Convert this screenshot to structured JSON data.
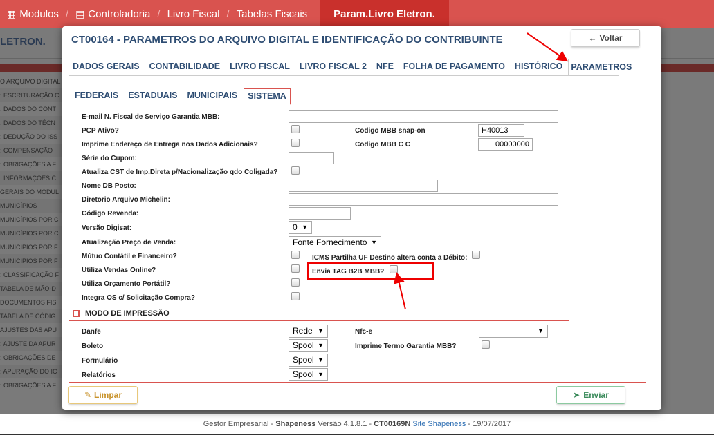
{
  "topnav": {
    "items": [
      {
        "icon": "grid-icon",
        "glyph": "▦",
        "label": "Modulos"
      },
      {
        "icon": "document-icon",
        "glyph": "▤",
        "label": "Controladoria"
      },
      {
        "label": "Livro Fiscal"
      },
      {
        "label": "Tabelas Fiscais"
      }
    ],
    "active": "Param.Livro Eletron."
  },
  "background": {
    "title": "LETRON.",
    "list": [
      "O ARQUIVO DIGITAL",
      ": ESCRITURAÇÃO C",
      ": DADOS DO CONT",
      ": DADOS DO TÉCN",
      ": DEDUÇÃO DO ISS",
      ": COMPENSAÇÃO",
      ": OBRIGAÇÕES A F",
      ": INFORMAÇÕES C",
      "GERAIS DO MODUL",
      "MUNICÍPIOS",
      "MUNICÍPIOS POR C",
      "MUNICÍPIOS POR C",
      "MUNICÍPIOS POR F",
      "MUNICÍPIOS POR F",
      ": CLASSIFICAÇÃO F",
      "TABELA DE MÃO-D",
      "DOCUMENTOS FIS",
      "TABELA DE CÓDIG",
      "AJUSTES DAS APU",
      ": AJUSTE DA APUR",
      ": OBRIGAÇÕES DE",
      ": APURAÇÃO DO IC",
      ": OBRIGAÇÕES A F"
    ]
  },
  "modal": {
    "title": "CT00164 - PARAMETROS DO ARQUIVO DIGITAL E IDENTIFICAÇÃO DO CONTRIBUINTE",
    "voltar": "Voltar",
    "limpar": "Limpar",
    "enviar": "Enviar",
    "tabs": [
      "DADOS GERAIS",
      "CONTABILIDADE",
      "LIVRO FISCAL",
      "LIVRO FISCAL 2",
      "NFE",
      "FOLHA DE PAGAMENTO",
      "HISTÓRICO",
      "PARAMETROS"
    ],
    "subtabs": [
      "FEDERAIS",
      "ESTADUAIS",
      "MUNICIPAIS",
      "SISTEMA"
    ],
    "fields": {
      "email_nf": "E-mail N. Fiscal de Serviço Garantia MBB:",
      "pcp_ativo": "PCP Ativo?",
      "codigo_snapon": "Codigo MBB snap-on",
      "codigo_snapon_value": "H40013",
      "imprime_endereco": "Imprime Endereço de Entrega nos Dados Adicionais?",
      "codigo_mbb_cc": "Codigo MBB C C",
      "codigo_mbb_cc_value": "00000000",
      "serie_cupom": "Série do Cupom:",
      "atualiza_cst": "Atualiza CST de Imp.Direta p/Nacionalização qdo Coligada?",
      "nome_db_posto": "Nome DB Posto:",
      "diretorio_michelin": "Diretorio Arquivo Michelin:",
      "codigo_revenda": "Código Revenda:",
      "versao_digisat": "Versão Digisat:",
      "versao_digisat_value": "0",
      "atualizacao_preco": "Atualização Preço de Venda:",
      "atualizacao_preco_value": "Fonte Fornecimento",
      "mutuo_contabil": "Mútuo Contátil e Financeiro?",
      "icms_partilha": "ICMS Partilha UF Destino altera conta a Débito:",
      "utiliza_vendas": "Utiliza Vendas Online?",
      "envia_tag": "Envia TAG B2B MBB?",
      "utiliza_orcamento": "Utiliza Orçamento Portátil?",
      "integra_os": "Integra OS c/ Solicitação Compra?"
    },
    "print_section": {
      "title": "MODO DE IMPRESSÃO",
      "danfe": "Danfe",
      "danfe_value": "Rede",
      "nfce": "Nfc-e",
      "nfce_value": "",
      "boleto": "Boleto",
      "boleto_value": "Spool",
      "imprime_termo": "Imprime Termo Garantia MBB?",
      "formulario": "Formulário",
      "formulario_value": "Spool",
      "relatorios": "Relatórios",
      "relatorios_value": "Spool"
    }
  },
  "footer": {
    "prefix": "Gestor Empresarial - ",
    "brand": "Shapeness",
    "version": " Versão 4.1.8.1 - ",
    "code": "CT00169N",
    "link": "Site Shapeness",
    "date": " - 19/07/2017"
  },
  "colors": {
    "accent": "#d9534f",
    "title": "#2e4d73",
    "annotation": "#ee0000"
  }
}
